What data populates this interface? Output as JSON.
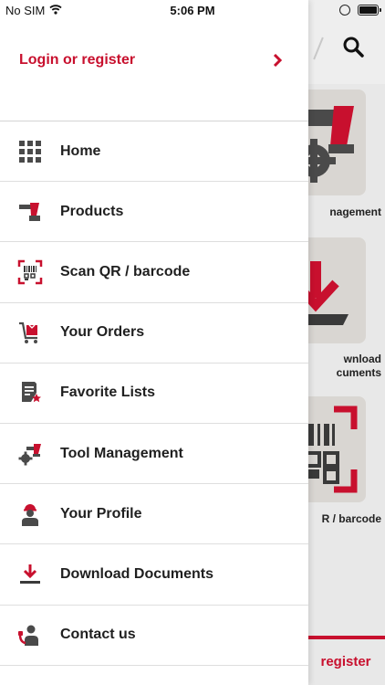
{
  "status": {
    "carrier": "No SIM",
    "time": "5:06 PM"
  },
  "drawer": {
    "login_label": "Login or register",
    "items": [
      {
        "label": "Home",
        "icon": "grid-icon"
      },
      {
        "label": "Products",
        "icon": "drill-icon"
      },
      {
        "label": "Scan QR / barcode",
        "icon": "qr-scan-icon"
      },
      {
        "label": "Your Orders",
        "icon": "cart-icon"
      },
      {
        "label": "Favorite Lists",
        "icon": "favorite-list-icon"
      },
      {
        "label": "Tool Management",
        "icon": "tool-gear-icon"
      },
      {
        "label": "Your Profile",
        "icon": "worker-icon"
      },
      {
        "label": "Download Documents",
        "icon": "download-icon"
      },
      {
        "label": "Contact us",
        "icon": "support-agent-icon"
      }
    ]
  },
  "background": {
    "tile_labels": [
      "nagement",
      "wnload\ncuments",
      "R / barcode"
    ],
    "bottom_text": "register"
  },
  "colors": {
    "accent": "#c8102e",
    "icon_dark": "#4a4a4a"
  }
}
